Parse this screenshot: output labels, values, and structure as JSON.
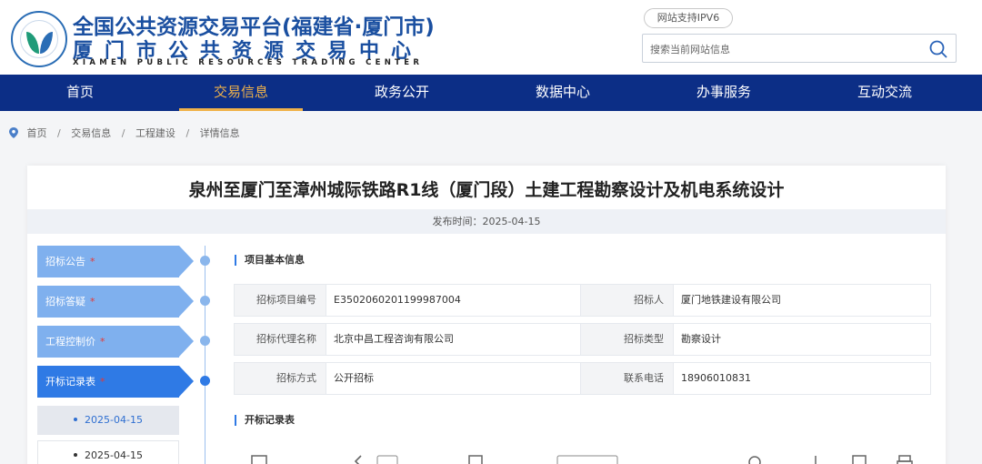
{
  "header": {
    "title_line1": "全国公共资源交易平台(福建省·厦门市)",
    "title_line2": "厦门市公共资源交易中心",
    "title_en": "XIAMEN PUBLIC RESOURCES TRADING CENTER",
    "ipv6_badge": "网站支持IPV6",
    "search_placeholder": "搜索当前网站信息"
  },
  "nav": {
    "items": [
      {
        "label": "首页"
      },
      {
        "label": "交易信息"
      },
      {
        "label": "政务公开"
      },
      {
        "label": "数据中心"
      },
      {
        "label": "办事服务"
      },
      {
        "label": "互动交流"
      }
    ],
    "active_index": 1
  },
  "breadcrumb": {
    "items": [
      "首页",
      "交易信息",
      "工程建设",
      "详情信息"
    ],
    "separator": "/"
  },
  "detail": {
    "title": "泉州至厦门至漳州城际铁路R1线（厦门段）土建工程勘察设计及机电系统设计",
    "publish_time": "发布时间：2025-04-15"
  },
  "sidebar": {
    "steps": [
      {
        "label": "招标公告",
        "star": "*"
      },
      {
        "label": "招标答疑",
        "star": "*"
      },
      {
        "label": "工程控制价",
        "star": "*"
      },
      {
        "label": "开标记录表",
        "star": "*"
      }
    ],
    "active_step": 3,
    "dates": [
      "2025-04-15",
      "2025-04-15"
    ]
  },
  "project_info": {
    "section_title": "项目基本信息",
    "rows": [
      {
        "label1": "招标项目编号",
        "value1": "E3502060201199987004",
        "label2": "招标人",
        "value2": "厦门地铁建设有限公司"
      },
      {
        "label1": "招标代理名称",
        "value1": "北京中昌工程咨询有限公司",
        "label2": "招标类型",
        "value2": "勘察设计"
      },
      {
        "label1": "招标方式",
        "value1": "公开招标",
        "label2": "联系电话",
        "value2": "18906010831"
      }
    ]
  },
  "bid_record": {
    "section_title": "开标记录表"
  },
  "colors": {
    "nav_bg": "#0c2e86",
    "nav_active": "#f0b24a",
    "brand_blue": "#1a4fa0",
    "step_active": "#2f7ae5",
    "step_inactive": "#7fb0ee",
    "required_star": "#e53935"
  }
}
